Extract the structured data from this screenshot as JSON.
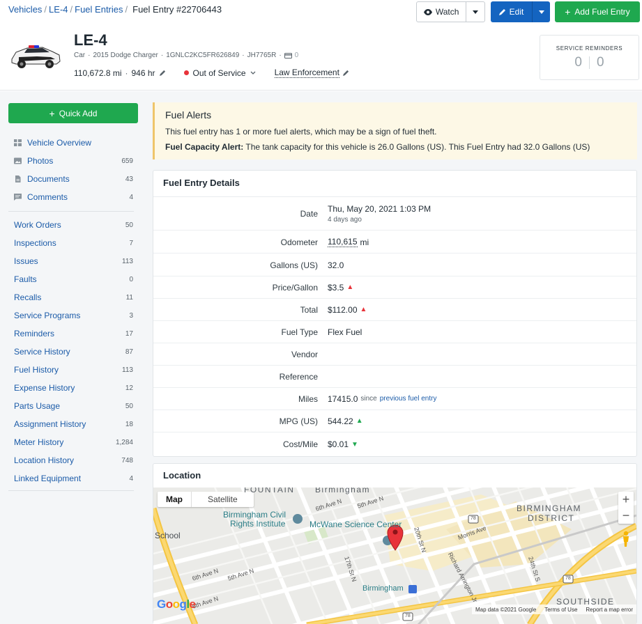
{
  "breadcrumb": {
    "items": [
      "Vehicles",
      "LE-4",
      "Fuel Entries"
    ],
    "current": "Fuel Entry #22706443"
  },
  "actions": {
    "watch": "Watch",
    "edit": "Edit",
    "add_fuel_entry": "Add Fuel Entry"
  },
  "vehicle": {
    "name": "LE-4",
    "type": "Car",
    "model": "2015 Dodge Charger",
    "vin": "1GNLC2KC5FR626849",
    "plate": "JH7765R",
    "card_count": "0",
    "odometer": "110,672.8 mi",
    "hours": "946 hr",
    "status": "Out of Service",
    "group": "Law Enforcement"
  },
  "service_reminders": {
    "title": "SERVICE REMINDERS",
    "overdue": "0",
    "due_soon": "0"
  },
  "sidebar": {
    "quick_add": "Quick Add",
    "group1": [
      {
        "label": "Vehicle Overview",
        "count": "",
        "icon": "grid-icon"
      },
      {
        "label": "Photos",
        "count": "659",
        "icon": "image-icon"
      },
      {
        "label": "Documents",
        "count": "43",
        "icon": "document-icon"
      },
      {
        "label": "Comments",
        "count": "4",
        "icon": "comment-icon"
      }
    ],
    "group2": [
      {
        "label": "Work Orders",
        "count": "50"
      },
      {
        "label": "Inspections",
        "count": "7"
      },
      {
        "label": "Issues",
        "count": "113"
      },
      {
        "label": "Faults",
        "count": "0"
      },
      {
        "label": "Recalls",
        "count": "11"
      },
      {
        "label": "Service Programs",
        "count": "3"
      },
      {
        "label": "Reminders",
        "count": "17"
      },
      {
        "label": "Service History",
        "count": "87"
      },
      {
        "label": "Fuel History",
        "count": "113"
      },
      {
        "label": "Expense History",
        "count": "12"
      },
      {
        "label": "Parts Usage",
        "count": "50"
      },
      {
        "label": "Assignment History",
        "count": "18"
      },
      {
        "label": "Meter History",
        "count": "1,284"
      },
      {
        "label": "Location History",
        "count": "748"
      },
      {
        "label": "Linked Equipment",
        "count": "4"
      }
    ]
  },
  "alert": {
    "title": "Fuel Alerts",
    "message": "This fuel entry has 1 or more fuel alerts, which may be a sign of fuel theft.",
    "capacity_label": "Fuel Capacity Alert:",
    "capacity_text": " The tank capacity for this vehicle is 26.0 Gallons (US). This Fuel Entry had 32.0 Gallons (US)"
  },
  "details": {
    "title": "Fuel Entry Details",
    "date_label": "Date",
    "date_value": "Thu, May 20, 2021 1:03 PM",
    "date_ago": "4 days ago",
    "odometer_label": "Odometer",
    "odometer_value": "110,615",
    "odometer_unit": "mi",
    "gallons_label": "Gallons (US)",
    "gallons_value": "32.0",
    "price_label": "Price/Gallon",
    "price_value": "$3.5",
    "total_label": "Total",
    "total_value": "$112.00",
    "fuel_type_label": "Fuel Type",
    "fuel_type_value": "Flex Fuel",
    "vendor_label": "Vendor",
    "vendor_value": "",
    "reference_label": "Reference",
    "reference_value": "",
    "miles_label": "Miles",
    "miles_value": "17415.0",
    "miles_since": "since",
    "miles_link": "previous fuel entry",
    "mpg_label": "MPG (US)",
    "mpg_value": "544.22",
    "cost_mile_label": "Cost/Mile",
    "cost_mile_value": "$0.01"
  },
  "location": {
    "title": "Location",
    "map_tab": "Map",
    "satellite_tab": "Satellite",
    "labels": {
      "fountain": "FOUNTAIN",
      "birmingham_top": "Birmingham",
      "district1": "BIRMINGHAM",
      "district2": "DISTRICT",
      "civil1": "Birmingham Civil",
      "civil2": "Rights Institute",
      "mcwane": "McWane Science Center",
      "school": "School",
      "ave6_1": "6th Ave N",
      "ave5": "5th Ave N",
      "ave6_2": "6th Ave N",
      "ave5_2": "5th Ave N",
      "ave6_3": "6th Ave N",
      "st17": "17th St N",
      "st20": "20th St N",
      "st24": "24th St S",
      "morris": "Morris Ave",
      "arrington": "Richard Arrington Jr",
      "birmingham_station": "Birmingham",
      "southside": "SOUTHSIDE",
      "route78a": "78",
      "route78b": "78",
      "route78c": "78"
    },
    "google": "Google",
    "map_data": "Map data ©2021 Google",
    "terms": "Terms of Use",
    "report": "Report a map error"
  }
}
